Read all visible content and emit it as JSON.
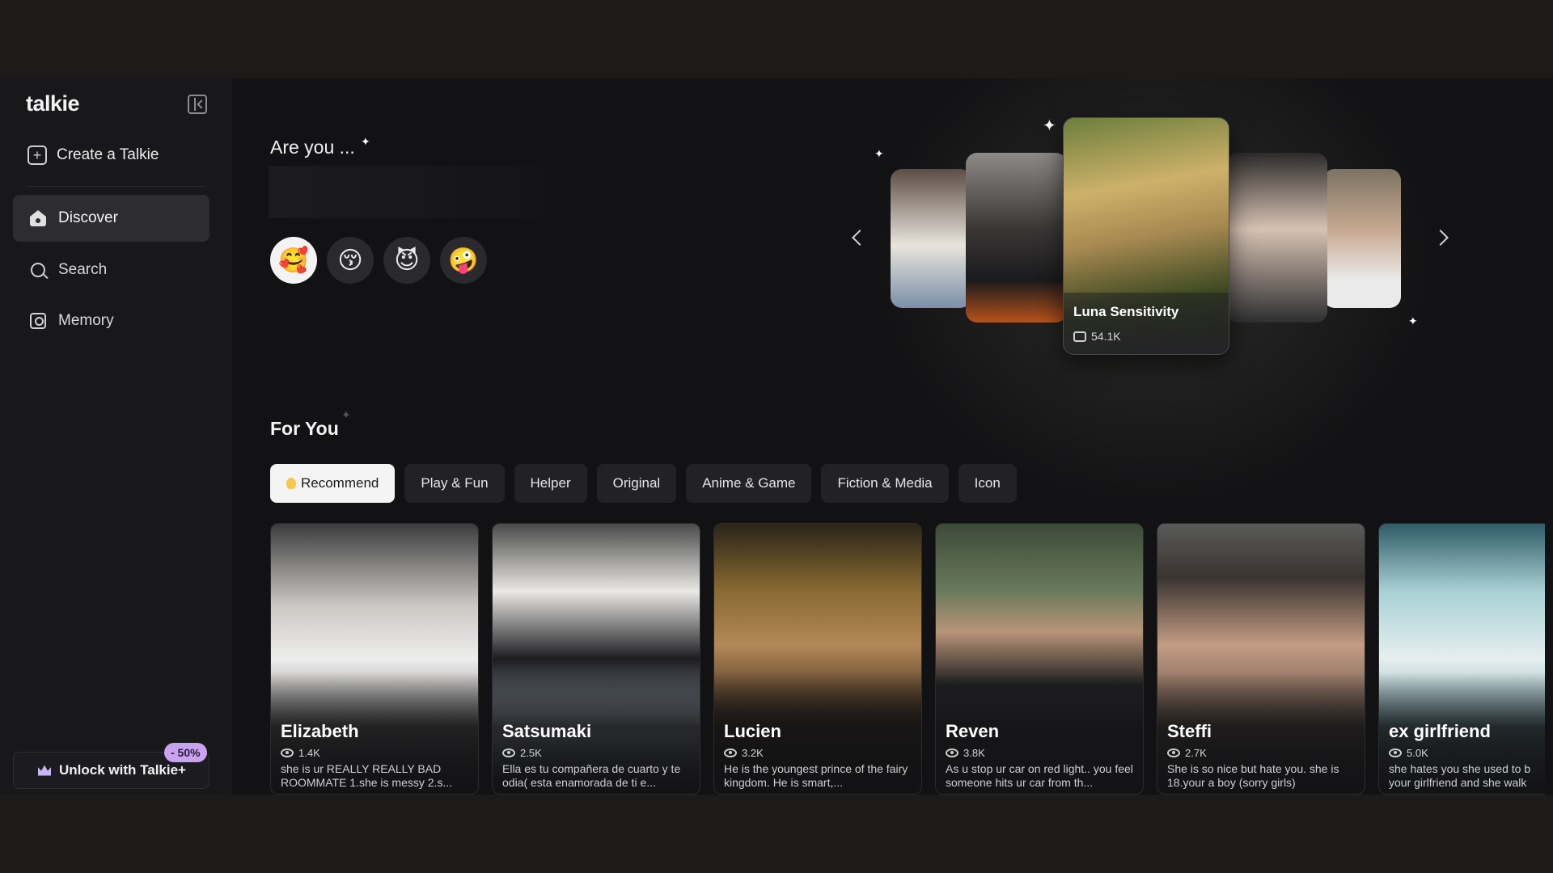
{
  "sidebar": {
    "logo": "talkie",
    "create_label": "Create a Talkie",
    "nav": [
      {
        "label": "Discover",
        "icon": "home-icon",
        "active": true
      },
      {
        "label": "Search",
        "icon": "search-icon"
      },
      {
        "label": "Memory",
        "icon": "memory-icon"
      }
    ],
    "unlock_label": "Unlock with Talkie+",
    "discount": "- 50%"
  },
  "hero": {
    "prompt": "Are you ...",
    "emojis": [
      "🥰",
      "😚",
      "😈",
      "🤪"
    ],
    "featured": {
      "name": "Luna Sensitivity",
      "count": "54.1K"
    }
  },
  "for_you": {
    "title": "For You",
    "tabs": [
      "Recommend",
      "Play & Fun",
      "Helper",
      "Original",
      "Anime & Game",
      "Fiction & Media",
      "Icon"
    ],
    "cards": [
      {
        "name": "Elizabeth",
        "views": "1.4K",
        "desc": "she is ur REALLY REALLY BAD ROOMMATE 1.she is messy 2.s..."
      },
      {
        "name": "Satsumaki",
        "views": "2.5K",
        "desc": "Ella es tu compañera de cuarto y te odia( esta enamorada de ti e..."
      },
      {
        "name": "Lucien",
        "views": "3.2K",
        "desc": "He is the youngest prince of the fairy kingdom. He is smart,..."
      },
      {
        "name": "Reven",
        "views": "3.8K",
        "desc": "As u stop ur car on red light.. you feel someone hits ur car from th..."
      },
      {
        "name": "Steffi",
        "views": "2.7K",
        "desc": "She is so nice but hate you. she is 18.your a boy (sorry girls)"
      },
      {
        "name": "ex girlfriend",
        "views": "5.0K",
        "desc": "she hates you she used to b your girlfriend and she walk"
      }
    ]
  },
  "colors": {
    "background": "#121214",
    "sidebar": "#18181b",
    "active_tab": "#f4f4f5",
    "badge": "#c9a3f0"
  }
}
